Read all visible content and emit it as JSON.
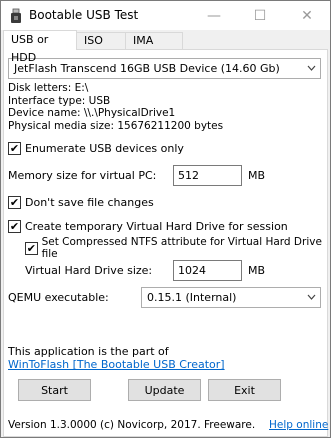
{
  "window": {
    "title": "Bootable USB Test",
    "minimize_glyph": "—",
    "maximize_glyph": "☐",
    "close_glyph": "✕"
  },
  "tabs": [
    {
      "label": "USB or HDD",
      "active": true
    },
    {
      "label": "ISO",
      "active": false
    },
    {
      "label": "IMA",
      "active": false
    }
  ],
  "device": {
    "selected": "JetFlash Transcend 16GB USB Device (14.60 Gb)",
    "disk_letters": "Disk letters: E:\\",
    "interface_type": "Interface type: USB",
    "device_name": "Device name: \\\\.\\PhysicalDrive1",
    "media_size": "Physical media size: 15676211200 bytes"
  },
  "options": {
    "enumerate_usb_label": "Enumerate USB devices only",
    "enumerate_usb_checked": true,
    "memory_label": "Memory size for virtual PC:",
    "memory_value": "512",
    "memory_unit": "MB",
    "dont_save_label": "Don't save file changes",
    "dont_save_checked": true,
    "create_vhd_label": "Create temporary Virtual Hard Drive for session",
    "create_vhd_checked": true,
    "compressed_ntfs_label": "Set Compressed NTFS attribute for Virtual Hard Drive file",
    "compressed_ntfs_checked": true,
    "vhd_size_label": "Virtual Hard Drive size:",
    "vhd_size_value": "1024",
    "vhd_size_unit": "MB",
    "qemu_label": "QEMU executable:",
    "qemu_value": "0.15.1 (Internal)"
  },
  "footer": {
    "part_of_text": "This application is the part of",
    "wintoflash_link": "WinToFlash [The Bootable USB Creator]",
    "start_label": "Start",
    "update_label": "Update",
    "exit_label": "Exit",
    "version_text": "Version 1.3.0000  (c) Novicorp, 2017. Freeware.",
    "help_link": "Help online"
  },
  "icons": {
    "app": "usb-app-icon",
    "dropdown": "chevron-down-icon",
    "check": "checkmark-icon"
  },
  "colors": {
    "link": "#0066cc",
    "panel_bg": "#ffffff",
    "window_bg": "#f0f0f0"
  }
}
